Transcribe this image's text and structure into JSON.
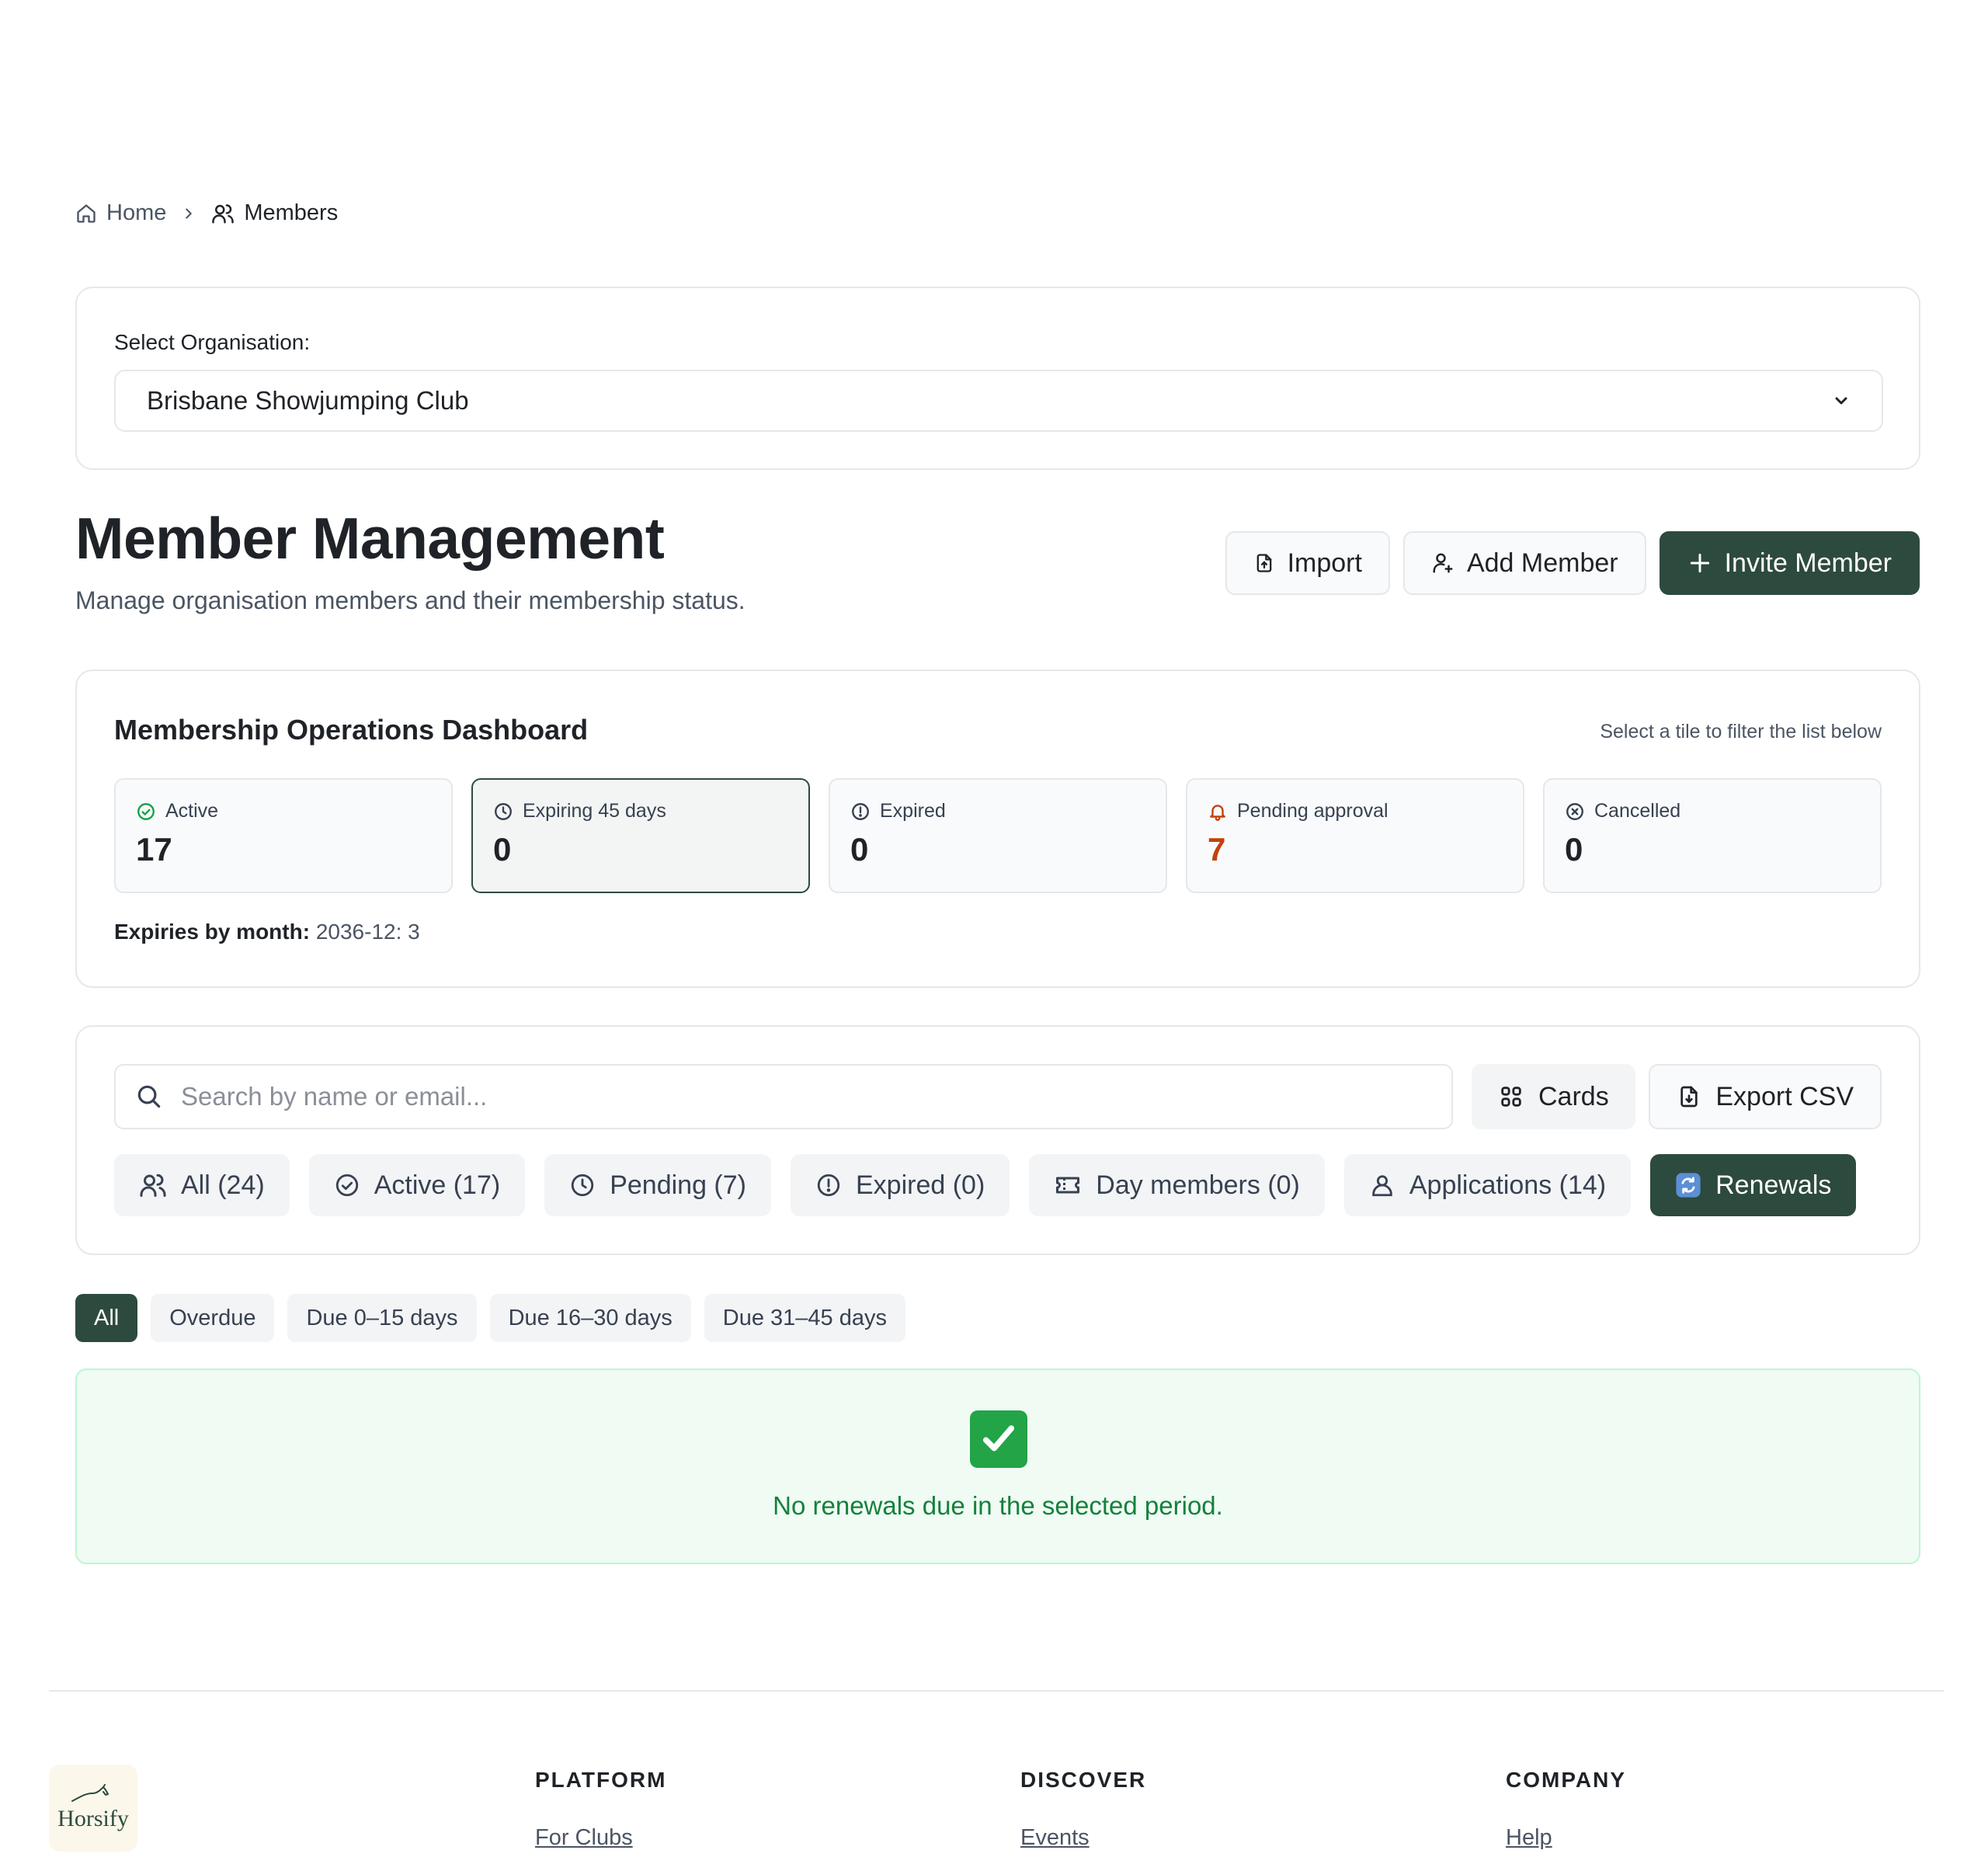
{
  "breadcrumb": {
    "home": "Home",
    "current": "Members"
  },
  "org": {
    "label": "Select Organisation:",
    "selected": "Brisbane Showjumping Club"
  },
  "header": {
    "title": "Member Management",
    "subtitle": "Manage organisation members and their membership status.",
    "import_label": "Import",
    "add_label": "Add Member",
    "invite_label": "Invite Member"
  },
  "dashboard": {
    "title": "Membership Operations Dashboard",
    "hint": "Select a tile to filter the list below",
    "tiles": [
      {
        "label": "Active",
        "value": "17",
        "icon": "check-circle-icon",
        "color": "#16a34a"
      },
      {
        "label": "Expiring 45 days",
        "value": "0",
        "icon": "clock-icon",
        "color": "#374151"
      },
      {
        "label": "Expired",
        "value": "0",
        "icon": "alert-circle-icon",
        "color": "#374151"
      },
      {
        "label": "Pending approval",
        "value": "7",
        "icon": "bell-icon",
        "color": "#c2410c"
      },
      {
        "label": "Cancelled",
        "value": "0",
        "icon": "x-circle-icon",
        "color": "#374151"
      }
    ],
    "expiries_label": "Expiries by month:",
    "expiries_value": "2036-12: 3"
  },
  "search": {
    "placeholder": "Search by name or email..."
  },
  "view_toggle": {
    "label": "Cards"
  },
  "export": {
    "label": "Export CSV"
  },
  "tabs": [
    {
      "label": "All (24)",
      "icon": "users-icon"
    },
    {
      "label": "Active (17)",
      "icon": "check-circle-icon"
    },
    {
      "label": "Pending (7)",
      "icon": "clock-icon"
    },
    {
      "label": "Expired (0)",
      "icon": "alert-circle-icon"
    },
    {
      "label": "Day members (0)",
      "icon": "ticket-icon"
    },
    {
      "label": "Applications (14)",
      "icon": "user-icon"
    },
    {
      "label": "Renewals",
      "icon": "refresh-icon"
    }
  ],
  "chips": [
    "All",
    "Overdue",
    "Due 0–15 days",
    "Due 16–30 days",
    "Due 31–45 days"
  ],
  "empty": {
    "message": "No renewals due in the selected period."
  },
  "footer": {
    "logo": "Horsify",
    "columns": [
      {
        "title": "PLATFORM",
        "link": "For Clubs"
      },
      {
        "title": "DISCOVER",
        "link": "Events"
      },
      {
        "title": "COMPANY",
        "link": "Help"
      }
    ]
  },
  "colors": {
    "primary": "#2d4a3e",
    "success": "#15803d",
    "warning": "#c2410c"
  }
}
